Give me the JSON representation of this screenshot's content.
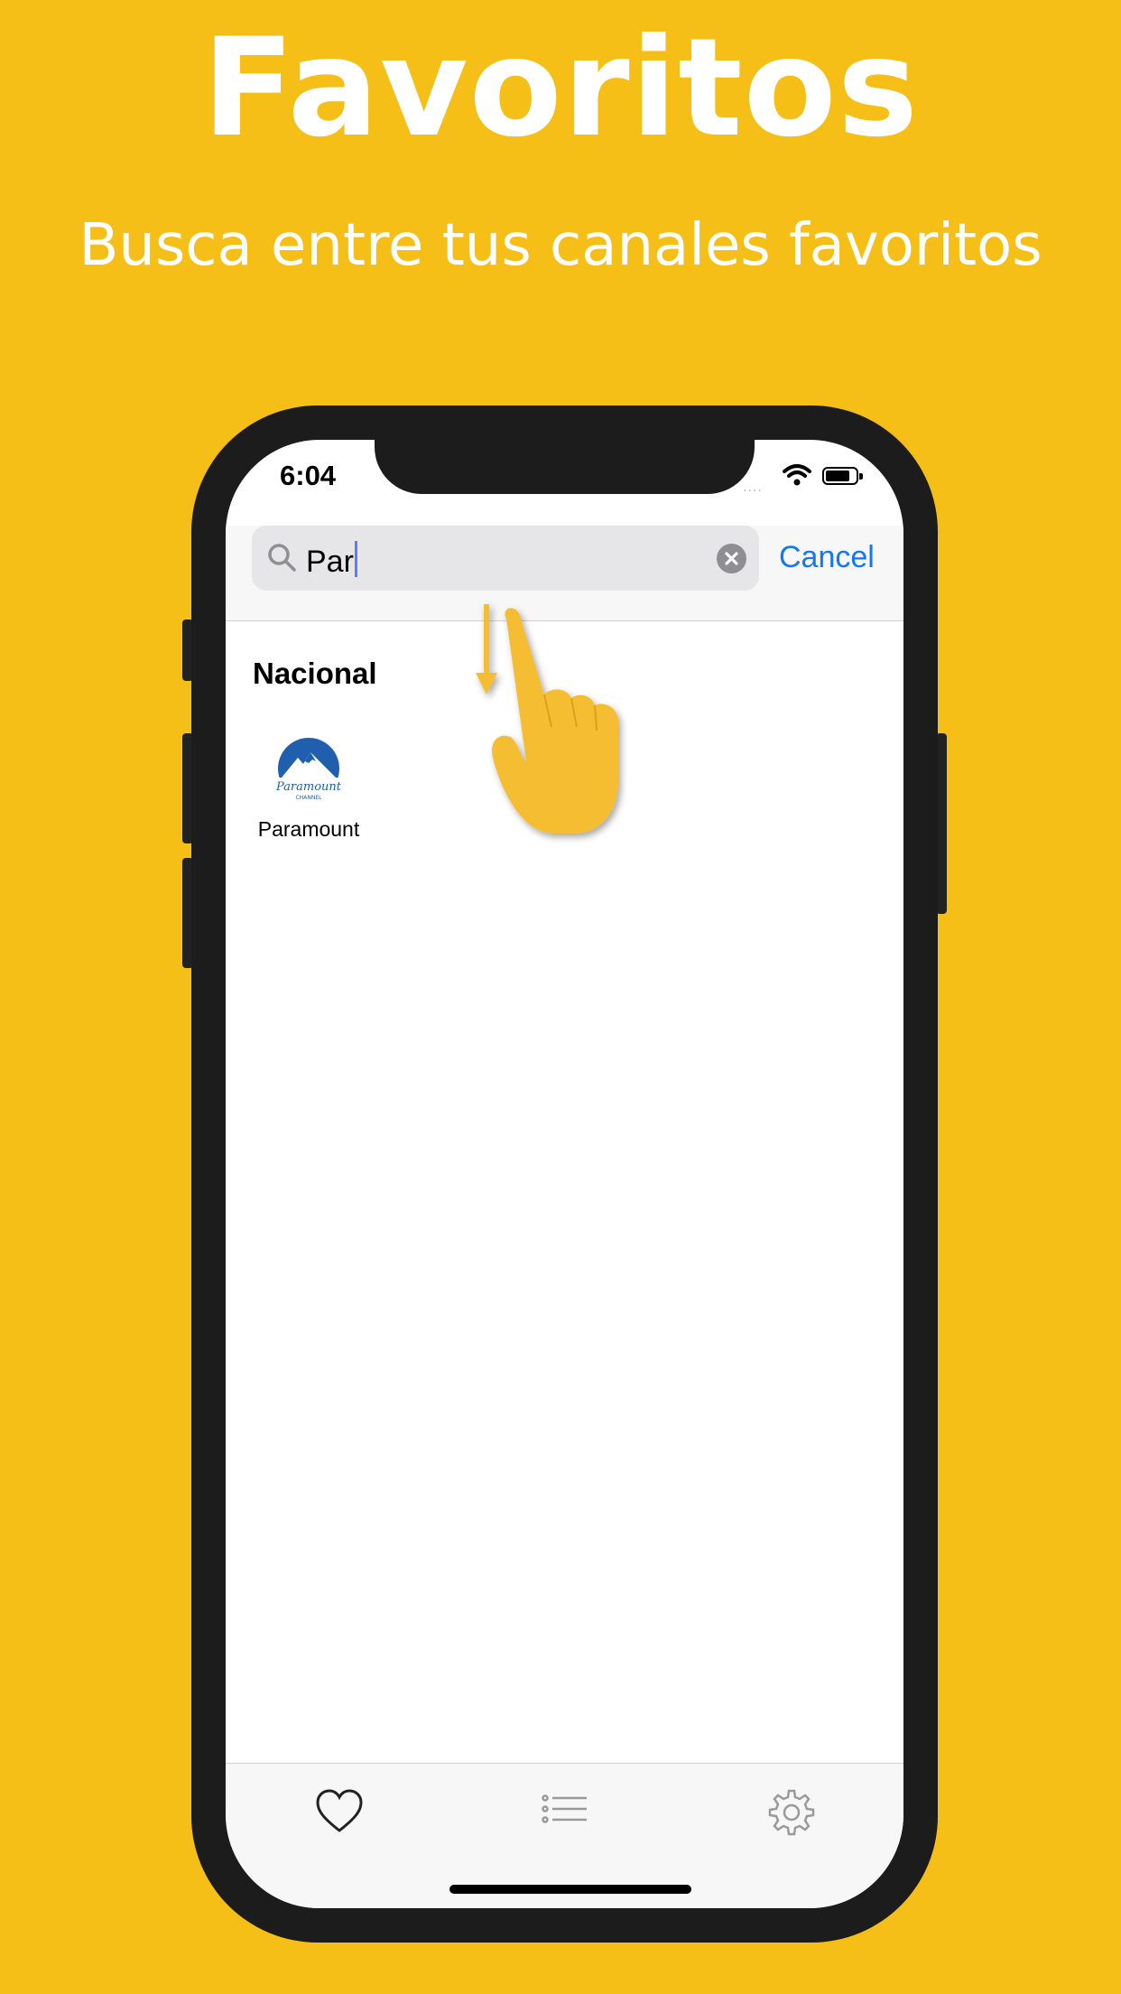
{
  "headline": "Favoritos",
  "subline": "Busca entre tus canales favoritos",
  "status_bar": {
    "time": "6:04",
    "signal": "....",
    "icons": [
      "wifi-icon",
      "battery-icon"
    ]
  },
  "search": {
    "value": "Par",
    "cancel_label": "Cancel"
  },
  "section": {
    "title": "Nacional"
  },
  "channels": [
    {
      "name": "Paramount",
      "logo": "paramount-channel-logo"
    }
  ],
  "tabbar": {
    "tabs": [
      "heart-icon",
      "list-icon",
      "gear-icon"
    ],
    "selected": 0
  },
  "colors": {
    "background": "#F5BF17",
    "accent": "#1477F8",
    "hand": "#F5BD30"
  }
}
